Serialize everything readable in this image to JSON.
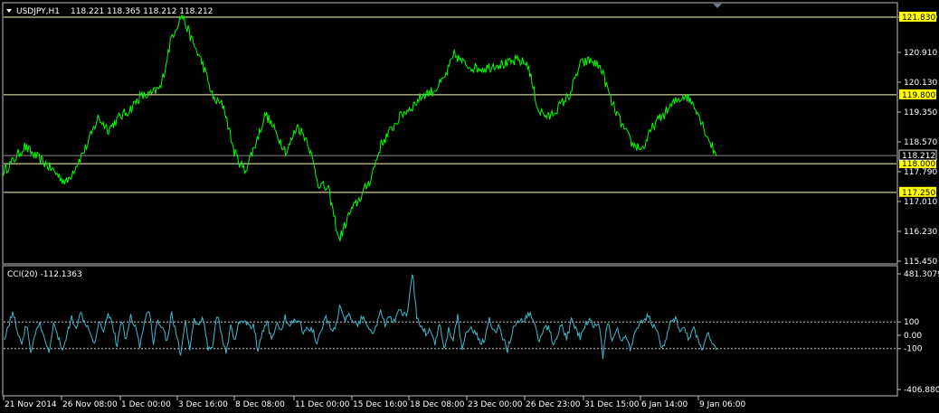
{
  "chart_data": [
    {
      "type": "line",
      "title": "USDJPY,H1",
      "ohlc": "118.221 118.365 118.212 118.212",
      "ylim": [
        115.45,
        121.83
      ],
      "y_ticks": [
        "121.830",
        "120.910",
        "120.130",
        "119.350",
        "118.570",
        "117.790",
        "117.010",
        "116.230",
        "115.450"
      ],
      "levels": [
        {
          "value": 121.83,
          "label": "121.830"
        },
        {
          "value": 119.8,
          "label": "119.800"
        },
        {
          "value": 118.0,
          "label": "118.000"
        },
        {
          "value": 117.25,
          "label": "117.250"
        }
      ],
      "current_price": {
        "value": 118.212,
        "label": "118.212"
      },
      "x_labels": [
        "21 Nov 2014",
        "26 Nov 08:00",
        "1 Dec 00:00",
        "3 Dec 16:00",
        "8 Dec 08:00",
        "11 Dec 00:00",
        "15 Dec 16:00",
        "18 Dec 08:00",
        "23 Dec 00:00",
        "26 Dec 23:00",
        "31 Dec 15:00",
        "6 Jan 14:00",
        "9 Jan 06:00"
      ],
      "series": [
        {
          "color": "#00ff00",
          "values": [
            117.8,
            118.1,
            118.45,
            118.2,
            118.0,
            117.75,
            117.5,
            118.0,
            118.5,
            119.2,
            118.9,
            119.2,
            119.4,
            119.75,
            119.8,
            120.0,
            121.3,
            121.9,
            121.2,
            120.6,
            119.7,
            119.5,
            118.3,
            117.8,
            118.5,
            119.3,
            118.8,
            118.3,
            119.0,
            118.6,
            117.5,
            117.3,
            116.0,
            116.7,
            117.1,
            117.6,
            118.5,
            118.9,
            119.3,
            119.5,
            119.8,
            119.9,
            120.2,
            120.85,
            120.6,
            120.5,
            120.5,
            120.6,
            120.6,
            120.7,
            120.6,
            119.4,
            119.2,
            119.5,
            119.8,
            120.6,
            120.7,
            120.5,
            119.6,
            119.0,
            118.5,
            118.4,
            119.0,
            119.3,
            119.6,
            119.8,
            119.5,
            118.8,
            118.2
          ]
        }
      ]
    },
    {
      "type": "line",
      "title": "CCI(20) -112.1363",
      "ylim": [
        -406.8805,
        481.3079
      ],
      "y_ticks": [
        "481.3079",
        "100",
        "0.00",
        "-100",
        "-406.8805"
      ],
      "levels": [
        {
          "value": 100
        },
        {
          "value": -100
        }
      ],
      "series": [
        {
          "color": "#40b8c8",
          "values": [
            -30,
            60,
            180,
            40,
            -60,
            80,
            -120,
            20,
            80,
            -40,
            -130,
            90,
            -20,
            -110,
            10,
            130,
            70,
            160,
            100,
            40,
            -60,
            110,
            40,
            170,
            80,
            -90,
            120,
            -40,
            150,
            70,
            -90,
            90,
            200,
            -60,
            120,
            60,
            -40,
            160,
            20,
            -150,
            90,
            -110,
            110,
            70,
            130,
            -100,
            -80,
            160,
            0,
            -130,
            60,
            -40,
            110,
            120,
            60,
            80,
            -110,
            20,
            100,
            -30,
            80,
            40,
            140,
            50,
            120,
            100,
            20,
            60,
            40,
            -60,
            40,
            130,
            40,
            70,
            210,
            110,
            150,
            80,
            90,
            130,
            70,
            20,
            60,
            170,
            80,
            140,
            100,
            180,
            150,
            160,
            480,
            140,
            60,
            20,
            40,
            -60,
            90,
            -100,
            40,
            -40,
            140,
            -120,
            30,
            40,
            10,
            -60,
            -20,
            120,
            20,
            60,
            -30,
            -110,
            30,
            80,
            100,
            130,
            160,
            110,
            -60,
            60,
            60,
            -60,
            10,
            80,
            -40,
            120,
            40,
            -20,
            80,
            110,
            60,
            110,
            -160,
            90,
            -20,
            60,
            -60,
            10,
            -110,
            0,
            70,
            120,
            150,
            80,
            40,
            -110,
            -20,
            100,
            130,
            40,
            70,
            -40,
            50,
            -30,
            -120,
            40,
            -80,
            -112
          ]
        }
      ]
    }
  ]
}
